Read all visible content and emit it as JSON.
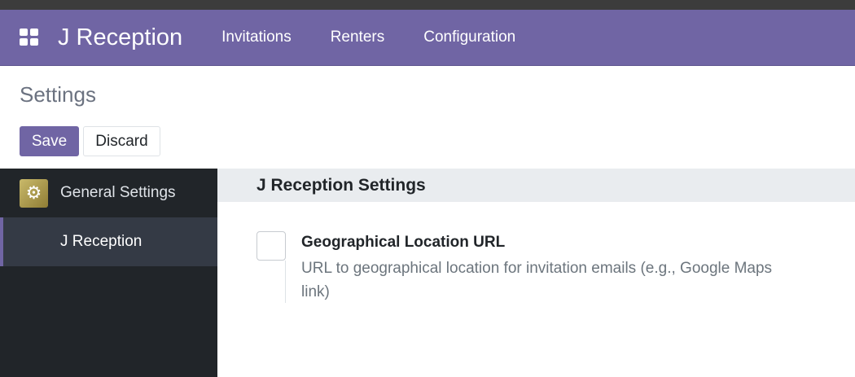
{
  "navbar": {
    "app_name": "J Reception",
    "menu": [
      "Invitations",
      "Renters",
      "Configuration"
    ]
  },
  "control_panel": {
    "title": "Settings",
    "save_label": "Save",
    "discard_label": "Discard"
  },
  "sidebar": {
    "app_label": "General Settings",
    "active_item": "J Reception"
  },
  "settings_section": {
    "title": "J Reception Settings",
    "setting": {
      "label": "Geographical Location URL",
      "description": "URL to geographical location for invitation emails (e.g., Google Maps link)",
      "checked": false
    }
  },
  "colors": {
    "brand": "#7065a4",
    "sidebar_bg": "#212529",
    "sidebar_active": "#343a45"
  }
}
